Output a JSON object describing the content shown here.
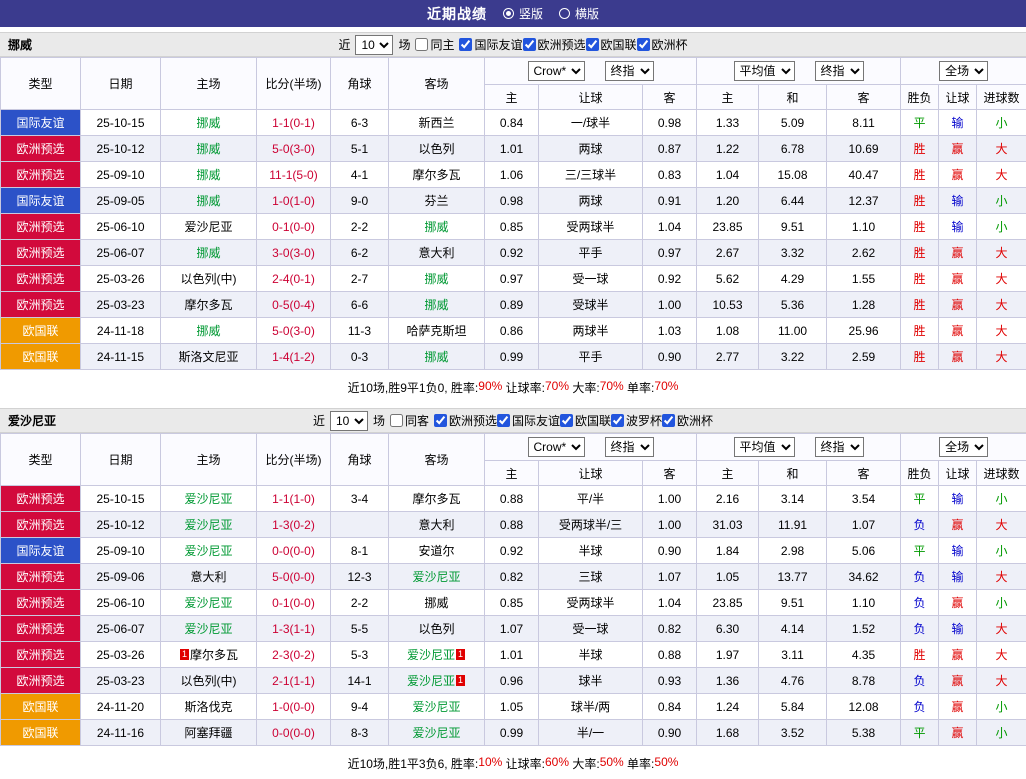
{
  "topbar": {
    "title": "近期战绩",
    "radio_vertical": "竖版",
    "radio_horizontal": "横版"
  },
  "table_header": {
    "type": "类型",
    "date": "日期",
    "home": "主场",
    "score": "比分(半场)",
    "corner": "角球",
    "away": "客场",
    "dd_crow": "Crow*",
    "dd_final": "终指",
    "dd_avg": "平均值",
    "dd_full": "全场",
    "h": "主",
    "handicap": "让球",
    "a": "客",
    "avg_h": "主",
    "avg_d": "和",
    "avg_a": "客",
    "result": "胜负",
    "hr": "让球",
    "goals": "进球数"
  },
  "colors": {
    "accent": "#3b3b8e",
    "focus_team": "#009933",
    "score": "#cc0033",
    "type_map": {
      "国际友谊": "#2c52c8",
      "欧洲预选": "#d20a3c",
      "欧国联": "#f09a00"
    },
    "result_map": {
      "胜": "c-red",
      "赢": "c-red",
      "大": "c-red",
      "平": "c-green",
      "小": "c-green",
      "负": "c-blue",
      "输": "c-blue"
    }
  },
  "sections": [
    {
      "team": "挪威",
      "filter": {
        "prefix": "近",
        "count": "10",
        "suffix": "场",
        "same_label": "同主",
        "leagues": [
          "国际友谊",
          "欧洲预选",
          "欧国联",
          "欧洲杯"
        ]
      },
      "rows": [
        {
          "type": "国际友谊",
          "date": "25-10-15",
          "home": "挪威",
          "home_g": true,
          "score": "1-1(0-1)",
          "corner": "6-3",
          "away": "新西兰",
          "o1": "0.84",
          "hd": "一/球半",
          "o2": "0.98",
          "m1": "1.33",
          "m2": "5.09",
          "m3": "8.11",
          "r": "平",
          "rl": "输",
          "g": "小"
        },
        {
          "type": "欧洲预选",
          "date": "25-10-12",
          "home": "挪威",
          "home_g": true,
          "score": "5-0(3-0)",
          "corner": "5-1",
          "away": "以色列",
          "o1": "1.01",
          "hd": "两球",
          "o2": "0.87",
          "m1": "1.22",
          "m2": "6.78",
          "m3": "10.69",
          "r": "胜",
          "rl": "赢",
          "g": "大"
        },
        {
          "type": "欧洲预选",
          "date": "25-09-10",
          "home": "挪威",
          "home_g": true,
          "score": "11-1(5-0)",
          "corner": "4-1",
          "away": "摩尔多瓦",
          "o1": "1.06",
          "hd": "三/三球半",
          "o2": "0.83",
          "m1": "1.04",
          "m2": "15.08",
          "m3": "40.47",
          "r": "胜",
          "rl": "赢",
          "g": "大"
        },
        {
          "type": "国际友谊",
          "date": "25-09-05",
          "home": "挪威",
          "home_g": true,
          "score": "1-0(1-0)",
          "corner": "9-0",
          "away": "芬兰",
          "o1": "0.98",
          "hd": "两球",
          "o2": "0.91",
          "m1": "1.20",
          "m2": "6.44",
          "m3": "12.37",
          "r": "胜",
          "rl": "输",
          "g": "小"
        },
        {
          "type": "欧洲预选",
          "date": "25-06-10",
          "home": "爱沙尼亚",
          "score": "0-1(0-0)",
          "corner": "2-2",
          "away": "挪威",
          "away_g": true,
          "o1": "0.85",
          "hd": "受两球半",
          "o2": "1.04",
          "m1": "23.85",
          "m2": "9.51",
          "m3": "1.10",
          "r": "胜",
          "rl": "输",
          "g": "小"
        },
        {
          "type": "欧洲预选",
          "date": "25-06-07",
          "home": "挪威",
          "home_g": true,
          "score": "3-0(3-0)",
          "corner": "6-2",
          "away": "意大利",
          "o1": "0.92",
          "hd": "平手",
          "o2": "0.97",
          "m1": "2.67",
          "m2": "3.32",
          "m3": "2.62",
          "r": "胜",
          "rl": "赢",
          "g": "大"
        },
        {
          "type": "欧洲预选",
          "date": "25-03-26",
          "home": "以色列(中)",
          "score": "2-4(0-1)",
          "corner": "2-7",
          "away": "挪威",
          "away_g": true,
          "o1": "0.97",
          "hd": "受一球",
          "o2": "0.92",
          "m1": "5.62",
          "m2": "4.29",
          "m3": "1.55",
          "r": "胜",
          "rl": "赢",
          "g": "大"
        },
        {
          "type": "欧洲预选",
          "date": "25-03-23",
          "home": "摩尔多瓦",
          "score": "0-5(0-4)",
          "corner": "6-6",
          "away": "挪威",
          "away_g": true,
          "o1": "0.89",
          "hd": "受球半",
          "o2": "1.00",
          "m1": "10.53",
          "m2": "5.36",
          "m3": "1.28",
          "r": "胜",
          "rl": "赢",
          "g": "大"
        },
        {
          "type": "欧国联",
          "date": "24-11-18",
          "home": "挪威",
          "home_g": true,
          "score": "5-0(3-0)",
          "corner": "11-3",
          "away": "哈萨克斯坦",
          "o1": "0.86",
          "hd": "两球半",
          "o2": "1.03",
          "m1": "1.08",
          "m2": "11.00",
          "m3": "25.96",
          "r": "胜",
          "rl": "赢",
          "g": "大"
        },
        {
          "type": "欧国联",
          "date": "24-11-15",
          "home": "斯洛文尼亚",
          "score": "1-4(1-2)",
          "corner": "0-3",
          "away": "挪威",
          "away_g": true,
          "o1": "0.99",
          "hd": "平手",
          "o2": "0.90",
          "m1": "2.77",
          "m2": "3.22",
          "m3": "2.59",
          "r": "胜",
          "rl": "赢",
          "g": "大"
        }
      ],
      "summary": [
        {
          "t": "近10场,胜9平1负0, 胜率:",
          "red": false
        },
        {
          "t": "90%",
          "red": true
        },
        {
          "t": " 让球率:",
          "red": false
        },
        {
          "t": "70%",
          "red": true
        },
        {
          "t": " 大率:",
          "red": false
        },
        {
          "t": "70%",
          "red": true
        },
        {
          "t": " 单率:",
          "red": false
        },
        {
          "t": "70%",
          "red": true
        }
      ]
    },
    {
      "team": "爱沙尼亚",
      "filter": {
        "prefix": "近",
        "count": "10",
        "suffix": "场",
        "same_label": "同客",
        "leagues": [
          "欧洲预选",
          "国际友谊",
          "欧国联",
          "波罗杯",
          "欧洲杯"
        ]
      },
      "rows": [
        {
          "type": "欧洲预选",
          "date": "25-10-15",
          "home": "爱沙尼亚",
          "home_g": true,
          "score": "1-1(1-0)",
          "corner": "3-4",
          "away": "摩尔多瓦",
          "o1": "0.88",
          "hd": "平/半",
          "o2": "1.00",
          "m1": "2.16",
          "m2": "3.14",
          "m3": "3.54",
          "r": "平",
          "rl": "输",
          "g": "小"
        },
        {
          "type": "欧洲预选",
          "date": "25-10-12",
          "home": "爱沙尼亚",
          "home_g": true,
          "score": "1-3(0-2)",
          "corner": "",
          "away": "意大利",
          "o1": "0.88",
          "hd": "受两球半/三",
          "o2": "1.00",
          "m1": "31.03",
          "m2": "11.91",
          "m3": "1.07",
          "r": "负",
          "rl": "赢",
          "g": "大"
        },
        {
          "type": "国际友谊",
          "date": "25-09-10",
          "home": "爱沙尼亚",
          "home_g": true,
          "score": "0-0(0-0)",
          "corner": "8-1",
          "away": "安道尔",
          "o1": "0.92",
          "hd": "半球",
          "o2": "0.90",
          "m1": "1.84",
          "m2": "2.98",
          "m3": "5.06",
          "r": "平",
          "rl": "输",
          "g": "小"
        },
        {
          "type": "欧洲预选",
          "date": "25-09-06",
          "home": "意大利",
          "score": "5-0(0-0)",
          "corner": "12-3",
          "away": "爱沙尼亚",
          "away_g": true,
          "o1": "0.82",
          "hd": "三球",
          "o2": "1.07",
          "m1": "1.05",
          "m2": "13.77",
          "m3": "34.62",
          "r": "负",
          "rl": "输",
          "g": "大"
        },
        {
          "type": "欧洲预选",
          "date": "25-06-10",
          "home": "爱沙尼亚",
          "home_g": true,
          "score": "0-1(0-0)",
          "corner": "2-2",
          "away": "挪威",
          "o1": "0.85",
          "hd": "受两球半",
          "o2": "1.04",
          "m1": "23.85",
          "m2": "9.51",
          "m3": "1.10",
          "r": "负",
          "rl": "赢",
          "g": "小"
        },
        {
          "type": "欧洲预选",
          "date": "25-06-07",
          "home": "爱沙尼亚",
          "home_g": true,
          "score": "1-3(1-1)",
          "corner": "5-5",
          "away": "以色列",
          "o1": "1.07",
          "hd": "受一球",
          "o2": "0.82",
          "m1": "6.30",
          "m2": "4.14",
          "m3": "1.52",
          "r": "负",
          "rl": "输",
          "g": "大"
        },
        {
          "type": "欧洲预选",
          "date": "25-03-26",
          "home": "摩尔多瓦",
          "home_card": true,
          "score": "2-3(0-2)",
          "corner": "5-3",
          "away": "爱沙尼亚",
          "away_g": true,
          "away_card": true,
          "o1": "1.01",
          "hd": "半球",
          "o2": "0.88",
          "m1": "1.97",
          "m2": "3.11",
          "m3": "4.35",
          "r": "胜",
          "rl": "赢",
          "g": "大"
        },
        {
          "type": "欧洲预选",
          "date": "25-03-23",
          "home": "以色列(中)",
          "score": "2-1(1-1)",
          "corner": "14-1",
          "away": "爱沙尼亚",
          "away_g": true,
          "away_card": true,
          "o1": "0.96",
          "hd": "球半",
          "o2": "0.93",
          "m1": "1.36",
          "m2": "4.76",
          "m3": "8.78",
          "r": "负",
          "rl": "赢",
          "g": "大"
        },
        {
          "type": "欧国联",
          "date": "24-11-20",
          "home": "斯洛伐克",
          "score": "1-0(0-0)",
          "corner": "9-4",
          "away": "爱沙尼亚",
          "away_g": true,
          "o1": "1.05",
          "hd": "球半/两",
          "o2": "0.84",
          "m1": "1.24",
          "m2": "5.84",
          "m3": "12.08",
          "r": "负",
          "rl": "赢",
          "g": "小"
        },
        {
          "type": "欧国联",
          "date": "24-11-16",
          "home": "阿塞拜疆",
          "score": "0-0(0-0)",
          "corner": "8-3",
          "away": "爱沙尼亚",
          "away_g": true,
          "o1": "0.99",
          "hd": "半/一",
          "o2": "0.90",
          "m1": "1.68",
          "m2": "3.52",
          "m3": "5.38",
          "r": "平",
          "rl": "赢",
          "g": "小"
        }
      ],
      "summary": [
        {
          "t": "近10场,胜1平3负6, 胜率:",
          "red": false
        },
        {
          "t": "10%",
          "red": true
        },
        {
          "t": " 让球率:",
          "red": false
        },
        {
          "t": "60%",
          "red": true
        },
        {
          "t": " 大率:",
          "red": false
        },
        {
          "t": "50%",
          "red": true
        },
        {
          "t": " 单率:",
          "red": false
        },
        {
          "t": "50%",
          "red": true
        }
      ]
    }
  ]
}
